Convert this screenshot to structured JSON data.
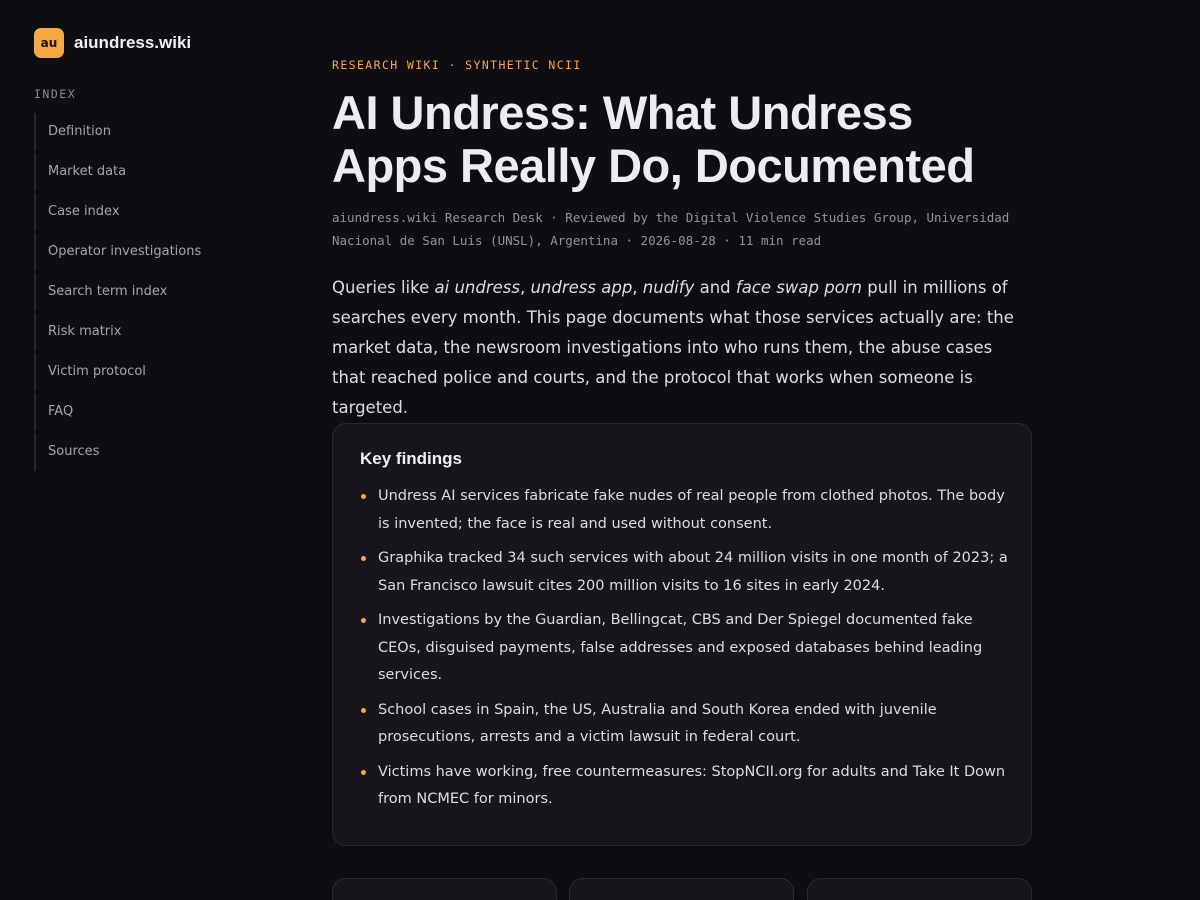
{
  "site": {
    "logo_text": "au",
    "name": "aiundress.wiki"
  },
  "sidebar": {
    "heading": "INDEX",
    "items": [
      {
        "label": "Definition"
      },
      {
        "label": "Market data"
      },
      {
        "label": "Case index"
      },
      {
        "label": "Operator investigations"
      },
      {
        "label": "Search term index"
      },
      {
        "label": "Risk matrix"
      },
      {
        "label": "Victim protocol"
      },
      {
        "label": "FAQ"
      },
      {
        "label": "Sources"
      }
    ]
  },
  "article": {
    "eyebrow": "RESEARCH WIKI · SYNTHETIC NCII",
    "title": "AI Undress: What Undress Apps Really Do, Documented",
    "byline": "aiundress.wiki Research Desk · Reviewed by the Digital Violence Studies Group, Universidad Nacional de San Luis (UNSL), Argentina · 2026-08-28 · 11 min read",
    "intro": {
      "prefix": "Queries like ",
      "term1": "ai undress",
      "sep1": ", ",
      "term2": "undress app",
      "sep2": ", ",
      "term3": "nudify",
      "sep3": " and ",
      "term4": "face swap porn",
      "rest": " pull in millions of searches every month. This page documents what those services actually are: the market data, the newsroom investigations into who runs them, the abuse cases that reached police and courts, and the protocol that works when someone is targeted."
    },
    "key_findings": {
      "title": "Key findings",
      "items": [
        "Undress AI services fabricate fake nudes of real people from clothed photos. The body is invented; the face is real and used without consent.",
        "Graphika tracked 34 such services with about 24 million visits in one month of 2023; a San Francisco lawsuit cites 200 million visits to 16 sites in early 2024.",
        "Investigations by the Guardian, Bellingcat, CBS and Der Spiegel documented fake CEOs, disguised payments, false addresses and exposed databases behind leading services.",
        "School cases in Spain, the US, Australia and South Korea ended with juvenile prosecutions, arrests and a victim lawsuit in federal court.",
        "Victims have working, free countermeasures: StopNCII.org for adults and Take It Down from NCMEC for minors."
      ]
    }
  },
  "colors": {
    "background": "#0e0e12",
    "accent": "#f5a940",
    "card": "#16161c",
    "border": "#2a2a33"
  }
}
